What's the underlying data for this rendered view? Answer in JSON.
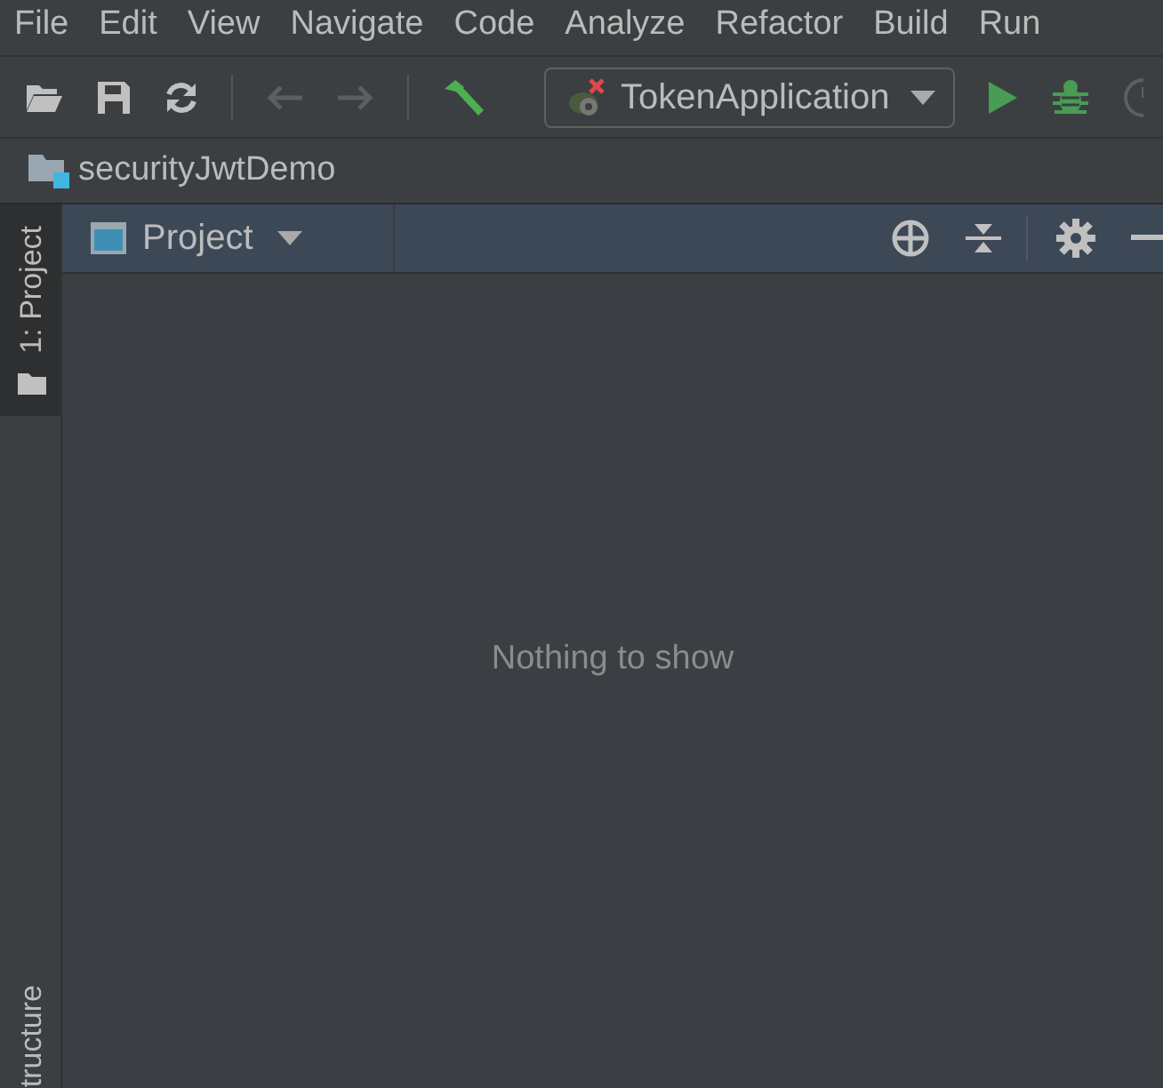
{
  "menu": [
    "File",
    "Edit",
    "View",
    "Navigate",
    "Code",
    "Analyze",
    "Refactor",
    "Build",
    "Run"
  ],
  "toolbar": {
    "run_configuration": "TokenApplication",
    "back_disabled": true,
    "forward_disabled": true
  },
  "navigation_bar": {
    "project": "securityJwtDemo"
  },
  "left_tool_tabs": [
    {
      "label": "1: Project",
      "selected": true,
      "kind": "top"
    },
    {
      "label": "tructure",
      "selected": false,
      "kind": "bottom"
    }
  ],
  "tool_window": {
    "title": "Project",
    "empty_text": "Nothing to show"
  }
}
